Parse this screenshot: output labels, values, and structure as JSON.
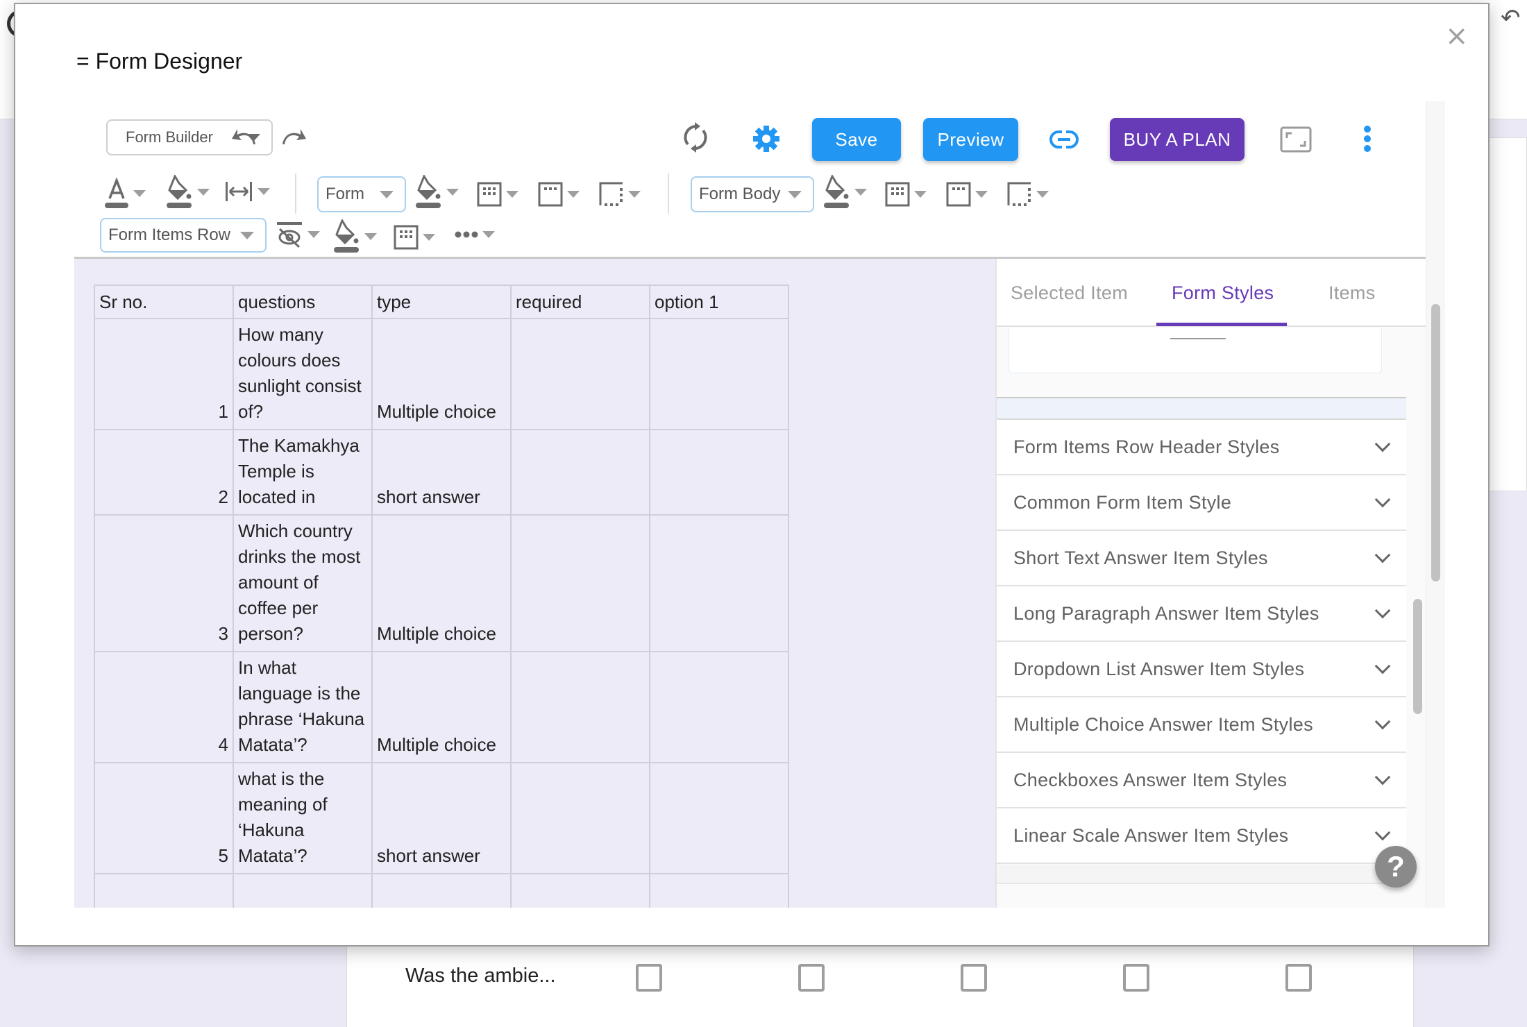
{
  "background": {
    "row_label": "Was the ambie...",
    "checkbox_count": 5
  },
  "modal": {
    "title": "= Form Designer",
    "close_label": "×"
  },
  "toolbar": {
    "mode_select": "Form Builder",
    "save_label": "Save",
    "preview_label": "Preview",
    "buy_label": "BUY A PLAN",
    "form_select": "Form",
    "form_body_select": "Form Body",
    "form_items_row_select": "Form Items Row",
    "colors": {
      "primary": "#2196f3",
      "buy": "#673ab7",
      "icon": "#6b6b6b"
    }
  },
  "table": {
    "headers": [
      "Sr no.",
      "questions",
      "type",
      "required",
      "option 1"
    ],
    "rows": [
      {
        "sr": "1",
        "question": "How many colours does sunlight consist of?",
        "type": "Multiple choice",
        "required": "",
        "option1": ""
      },
      {
        "sr": "2",
        "question": "The Kamakhya Temple is located in",
        "type": "short answer",
        "required": "",
        "option1": ""
      },
      {
        "sr": "3",
        "question": "Which country drinks the most amount of coffee per person?",
        "type": "Multiple choice",
        "required": "",
        "option1": ""
      },
      {
        "sr": "4",
        "question": "In what language is the phrase ‘Hakuna Matata’?",
        "type": "Multiple choice",
        "required": "",
        "option1": ""
      },
      {
        "sr": "5",
        "question": "what is the meaning of ‘Hakuna Matata’?",
        "type": "short answer",
        "required": "",
        "option1": ""
      },
      {
        "sr": "",
        "question": "",
        "type": "",
        "required": "",
        "option1": ""
      }
    ]
  },
  "panel": {
    "tabs": [
      {
        "label": "Selected Item",
        "active": false
      },
      {
        "label": "Form Styles",
        "active": true
      },
      {
        "label": "Items",
        "active": false
      }
    ],
    "sections": [
      "Form Items Row Header Styles",
      "Common Form Item Style",
      "Short Text Answer Item Styles",
      "Long Paragraph Answer Item Styles",
      "Dropdown List Answer Item Styles",
      "Multiple Choice Answer Item Styles",
      "Checkboxes Answer Item Styles",
      "Linear Scale Answer Item Styles"
    ],
    "help_label": "?"
  }
}
